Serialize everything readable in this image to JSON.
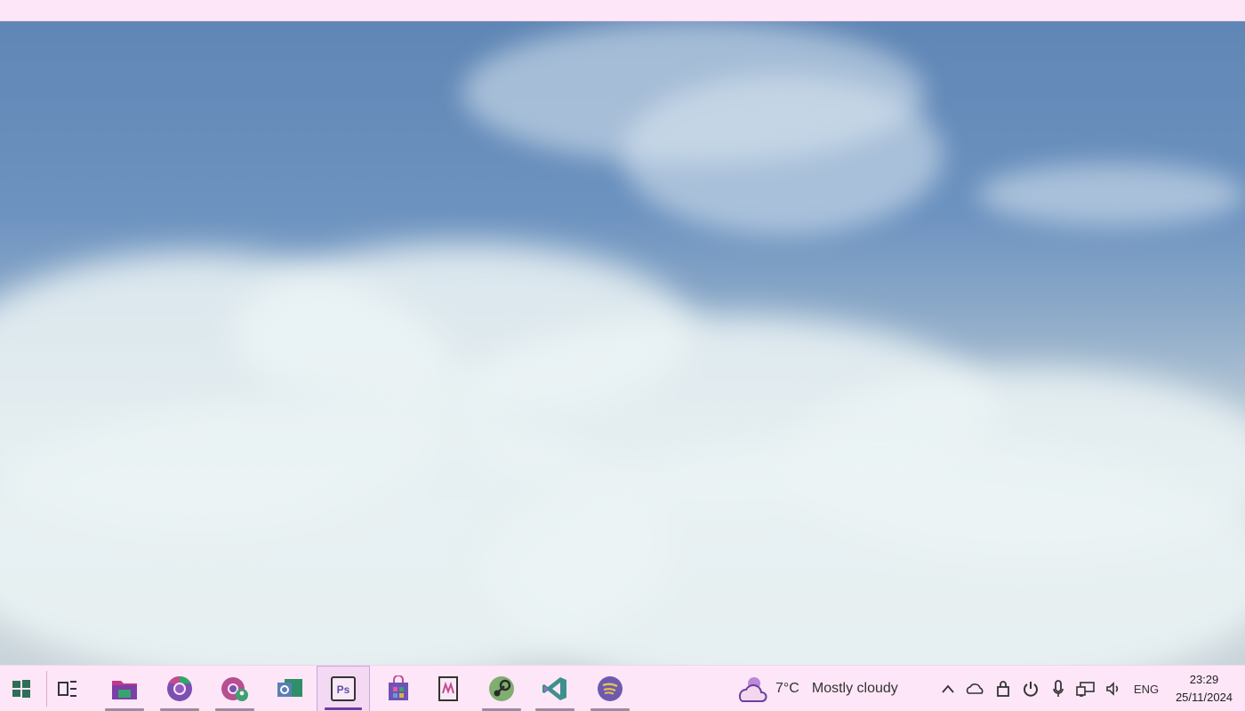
{
  "desktop": {
    "wallpaper": "cloudy-sky"
  },
  "taskbar": {
    "start_icon": "windows-logo-icon",
    "task_view_icon": "task-view-icon",
    "apps": [
      {
        "name": "file-explorer",
        "icon": "folder-icon",
        "open": true,
        "active": false
      },
      {
        "name": "chrome",
        "icon": "chrome-icon",
        "open": true,
        "active": false
      },
      {
        "name": "chrome-profile",
        "icon": "chrome-profile-icon",
        "open": true,
        "active": false
      },
      {
        "name": "outlook",
        "icon": "outlook-icon",
        "open": false,
        "active": false
      },
      {
        "name": "photoshop",
        "icon": "photoshop-icon",
        "open": true,
        "active": true
      },
      {
        "name": "app-store",
        "icon": "store-icon",
        "open": false,
        "active": false
      },
      {
        "name": "notes",
        "icon": "notes-icon",
        "open": false,
        "active": false
      },
      {
        "name": "steam",
        "icon": "steam-icon",
        "open": true,
        "active": false
      },
      {
        "name": "visual-studio",
        "icon": "visual-studio-icon",
        "open": true,
        "active": false
      },
      {
        "name": "spotify",
        "icon": "spotify-icon",
        "open": true,
        "active": false
      }
    ],
    "weather": {
      "icon": "cloudy-weather-icon",
      "temp": "7°C",
      "desc": "Mostly cloudy"
    },
    "tray": [
      "chevron-up-icon",
      "onedrive-icon",
      "lock-icon",
      "power-icon",
      "microphone-icon",
      "network-icon",
      "volume-icon"
    ],
    "language": "ENG",
    "time": "23:29",
    "date": "25/11/2024"
  },
  "colors": {
    "taskbar_bg": "#fde6f7",
    "accent": "#6a3fa0"
  }
}
